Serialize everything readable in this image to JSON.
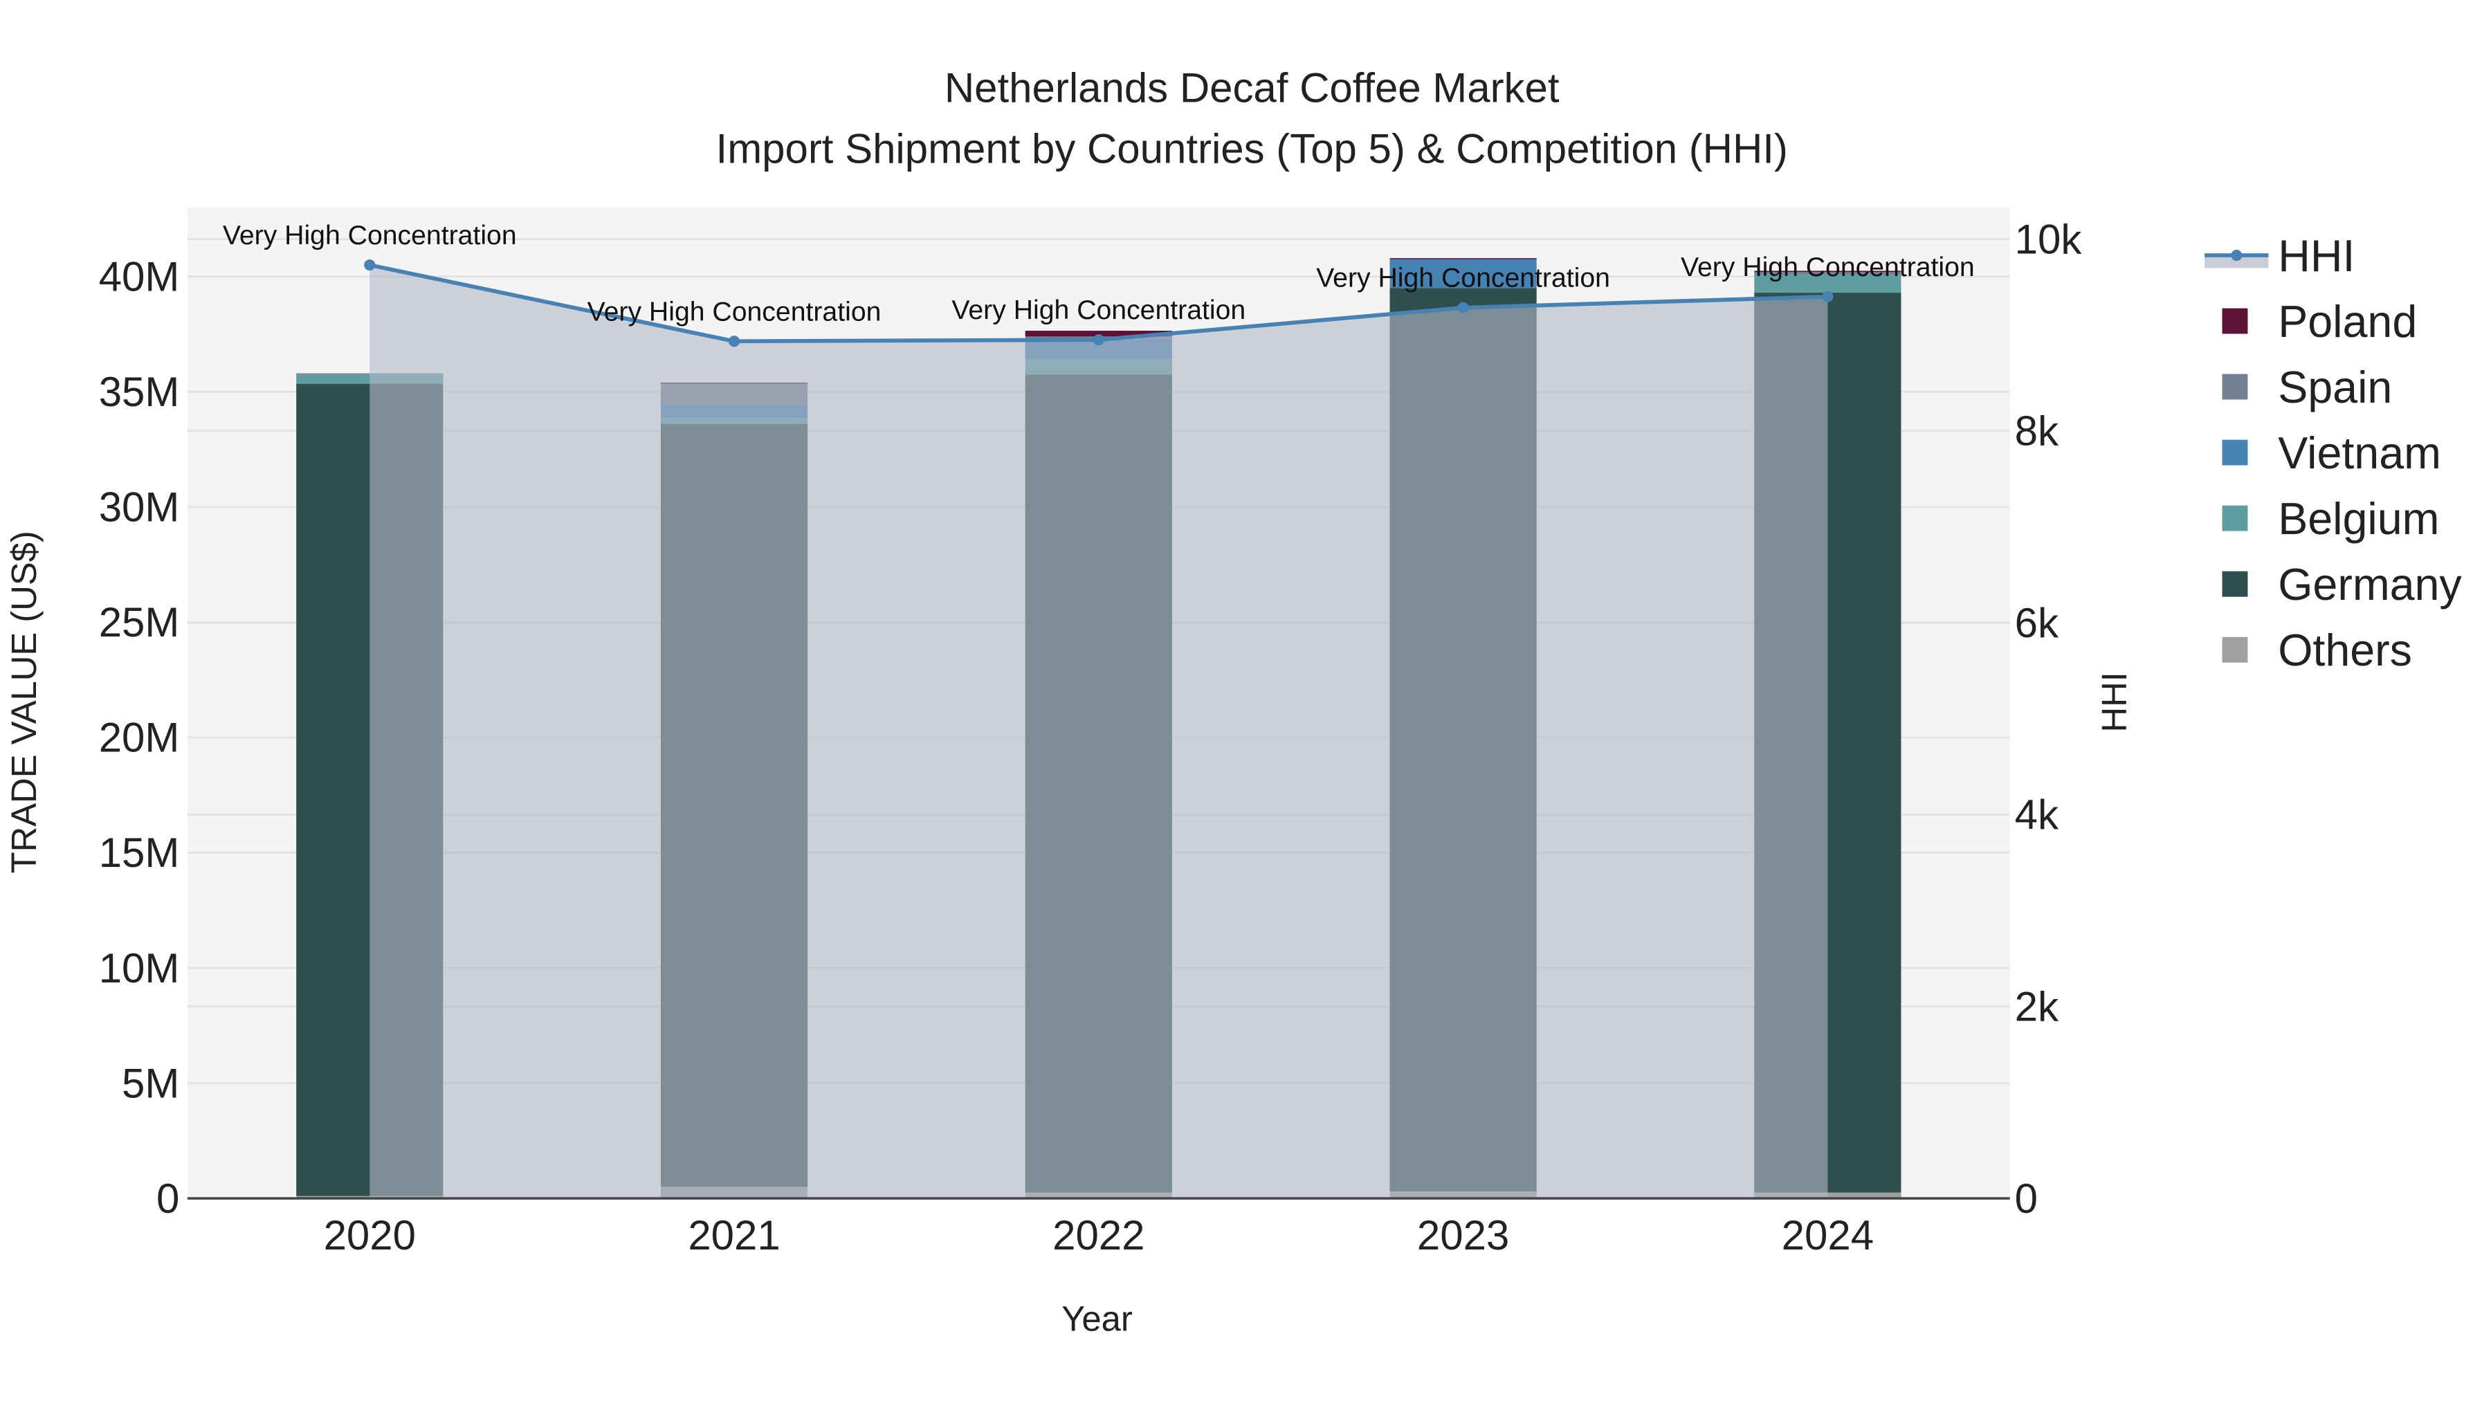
{
  "chart_data": {
    "type": "bar",
    "title": "Netherlands Decaf Coffee Market",
    "subtitle": "Import Shipment by Countries (Top 5) & Competition (HHI)",
    "xlabel": "Year",
    "ylabel": "TRADE VALUE (US$)",
    "y2label": "HHI",
    "categories": [
      "2020",
      "2021",
      "2022",
      "2023",
      "2024"
    ],
    "ylim": [
      0,
      43000000
    ],
    "y2lim": [
      0,
      10330
    ],
    "yticks": [
      {
        "v": 0,
        "label": "0"
      },
      {
        "v": 5000000,
        "label": "5M"
      },
      {
        "v": 10000000,
        "label": "10M"
      },
      {
        "v": 15000000,
        "label": "15M"
      },
      {
        "v": 20000000,
        "label": "20M"
      },
      {
        "v": 25000000,
        "label": "25M"
      },
      {
        "v": 30000000,
        "label": "30M"
      },
      {
        "v": 35000000,
        "label": "35M"
      },
      {
        "v": 40000000,
        "label": "40M"
      }
    ],
    "y2ticks": [
      {
        "v": 0,
        "label": "0"
      },
      {
        "v": 2000,
        "label": "2k"
      },
      {
        "v": 4000,
        "label": "4k"
      },
      {
        "v": 6000,
        "label": "6k"
      },
      {
        "v": 8000,
        "label": "8k"
      },
      {
        "v": 10000,
        "label": "10k"
      }
    ],
    "series": [
      {
        "name": "Others",
        "color": "#a0a0a0",
        "values": [
          100000,
          500000,
          250000,
          300000,
          250000
        ]
      },
      {
        "name": "Germany",
        "color": "#2f4f4f",
        "values": [
          35250000,
          33100000,
          35500000,
          39200000,
          39050000
        ]
      },
      {
        "name": "Belgium",
        "color": "#5f9ea0",
        "values": [
          400000,
          250000,
          650000,
          0,
          800000
        ]
      },
      {
        "name": "Vietnam",
        "color": "#4682b4",
        "values": [
          0,
          600000,
          900000,
          1250000,
          0
        ]
      },
      {
        "name": "Spain",
        "color": "#708090",
        "values": [
          50000,
          900000,
          100000,
          0,
          100000
        ]
      },
      {
        "name": "Poland",
        "color": "#5e1234",
        "values": [
          0,
          50000,
          250000,
          50000,
          50000
        ]
      }
    ],
    "line": {
      "name": "HHI",
      "color": "#4682b4",
      "values": [
        9730,
        8935,
        8950,
        9285,
        9400
      ],
      "annotations": [
        "Very High Concentration",
        "Very High Concentration",
        "Very High Concentration",
        "Very High Concentration",
        "Very High Concentration"
      ]
    },
    "legend": {
      "placement": "right",
      "order": [
        "HHI",
        "Poland",
        "Spain",
        "Vietnam",
        "Belgium",
        "Germany",
        "Others"
      ]
    },
    "grid": true
  }
}
